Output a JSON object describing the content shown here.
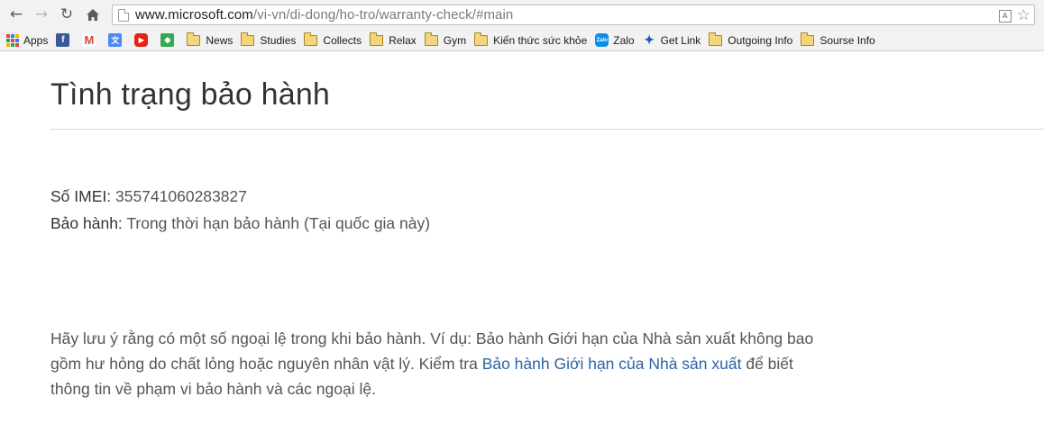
{
  "browser": {
    "url_host": "www.microsoft.com",
    "url_path": "/vi-vn/di-dong/ho-tro/warranty-check/#main",
    "back_icon": "arrow-left",
    "forward_icon": "arrow-right",
    "reload_icon": "reload",
    "home_icon": "home"
  },
  "bookmarks": [
    {
      "label": "Apps",
      "icon": "apps-grid"
    },
    {
      "label": "",
      "icon": "facebook"
    },
    {
      "label": "",
      "icon": "gmail"
    },
    {
      "label": "",
      "icon": "translate"
    },
    {
      "label": "",
      "icon": "youtube"
    },
    {
      "label": "",
      "icon": "maps"
    },
    {
      "label": "News",
      "icon": "folder"
    },
    {
      "label": "Studies",
      "icon": "folder"
    },
    {
      "label": "Collects",
      "icon": "folder"
    },
    {
      "label": "Relax",
      "icon": "folder"
    },
    {
      "label": "Gym",
      "icon": "folder"
    },
    {
      "label": "Kiến thức sức khỏe",
      "icon": "folder"
    },
    {
      "label": "Zalo",
      "icon": "zalo"
    },
    {
      "label": "Get Link",
      "icon": "getlink"
    },
    {
      "label": "Outgoing Info",
      "icon": "folder"
    },
    {
      "label": "Sourse Info",
      "icon": "folder"
    }
  ],
  "page": {
    "title": "Tình trạng bảo hành",
    "imei_label": "Số IMEI:",
    "imei_value": "355741060283827",
    "warranty_label": "Bảo hành:",
    "warranty_value": "Trong thời hạn bảo hành (Tại quốc gia này)",
    "note_before": "Hãy lưu ý rằng có một số ngoại lệ trong khi bảo hành. Ví dụ: Bảo hành Giới hạn của Nhà sản xuất không bao gồm hư hỏng do chất lỏng hoặc nguyên nhân vật lý. Kiểm tra ",
    "note_link": "Bảo hành Giới hạn của Nhà sản xuất",
    "note_after": " để biết thông tin về phạm vi bảo hành và các ngoại lệ."
  },
  "colors": {
    "link": "#2b63a8",
    "folder": "#f4d67a"
  }
}
